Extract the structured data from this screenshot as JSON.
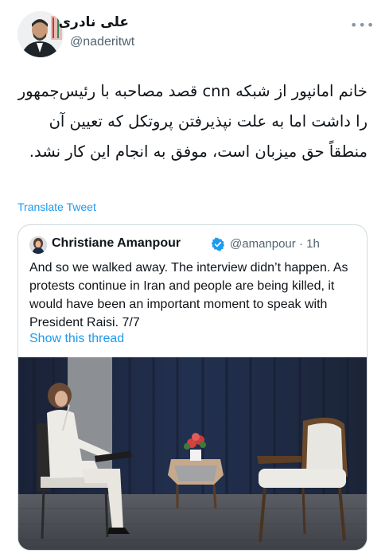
{
  "author": {
    "display_name": "علی نادری",
    "handle": "@naderitwt"
  },
  "tweet": {
    "text": "خانم امانپور از شبکه cnn قصد مصاحبه با رئیس‌جمهور را داشت اما به علت نپذیرفتن پروتکل که تعیین آن منطقاً حق میزبان است، موفق به انجام این کار نشد.",
    "translate_label": "Translate Tweet",
    "more_icon": "more-icon"
  },
  "quoted": {
    "display_name": "Christiane Amanpour",
    "handle_time": "@amanpour · 1h",
    "text": "And so we walked away. The interview didn’t happen. As protests continue in Iran and people are being killed, it would have been an important moment to speak with President Raisi. 7/7",
    "thread_link": "Show this thread",
    "verified_icon": "verified-badge-icon",
    "verified_color": "#1d9bf0"
  },
  "colors": {
    "link": "#1d9bf0",
    "secondary_text": "#536471",
    "border": "#cfd9de"
  }
}
